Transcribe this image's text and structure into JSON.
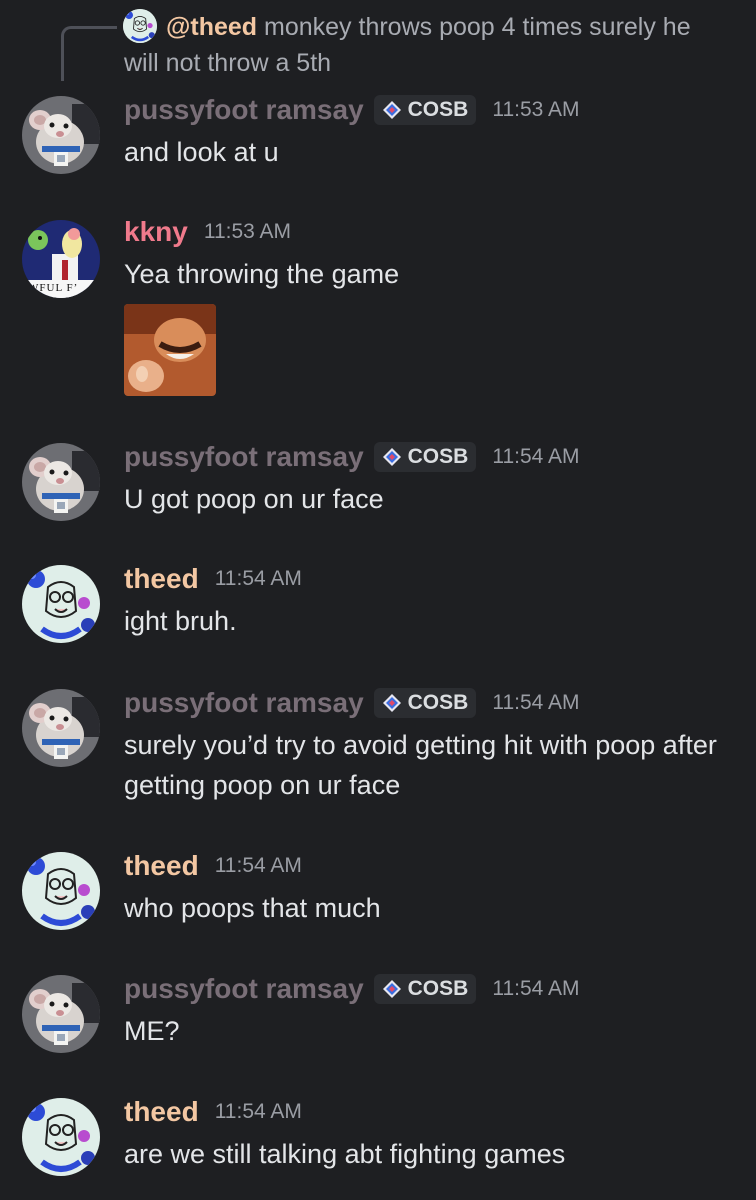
{
  "reply": {
    "mention": "@theed",
    "text": "monkey throws poop 4 times surely he will not throw a 5th"
  },
  "colors": {
    "background": "#1e1f22",
    "ramsay_name": "#7a6f78",
    "kkny_name": "#f07a8c",
    "theed_name": "#f3c7a3",
    "tag_bg": "#2b2d31"
  },
  "messages": [
    {
      "author": "pussyfoot ramsay",
      "tag": "COSB",
      "tag_icon": "diamond-icon",
      "time": "11:53 AM",
      "text": "and look at u",
      "avatar": "rat-avatar"
    },
    {
      "author": "kkny",
      "time": "11:53 AM",
      "text": "Yea throwing the game",
      "avatar": "kkny-avatar",
      "avatar_caption": "WFUL F’",
      "attachment": "laughing-pointing-emoji"
    },
    {
      "author": "pussyfoot ramsay",
      "tag": "COSB",
      "tag_icon": "diamond-icon",
      "time": "11:54 AM",
      "text": "U got poop on ur face",
      "avatar": "rat-avatar"
    },
    {
      "author": "theed",
      "time": "11:54 AM",
      "text": "ight bruh.",
      "avatar": "theed-avatar"
    },
    {
      "author": "pussyfoot ramsay",
      "tag": "COSB",
      "tag_icon": "diamond-icon",
      "time": "11:54 AM",
      "text": "surely you’d try to avoid getting hit with poop after getting poop on ur face",
      "avatar": "rat-avatar"
    },
    {
      "author": "theed",
      "time": "11:54 AM",
      "text": "who poops that much",
      "avatar": "theed-avatar"
    },
    {
      "author": "pussyfoot ramsay",
      "tag": "COSB",
      "tag_icon": "diamond-icon",
      "time": "11:54 AM",
      "text": "ME?",
      "avatar": "rat-avatar"
    },
    {
      "author": "theed",
      "time": "11:54 AM",
      "text": "are we still talking abt fighting games",
      "avatar": "theed-avatar"
    }
  ]
}
